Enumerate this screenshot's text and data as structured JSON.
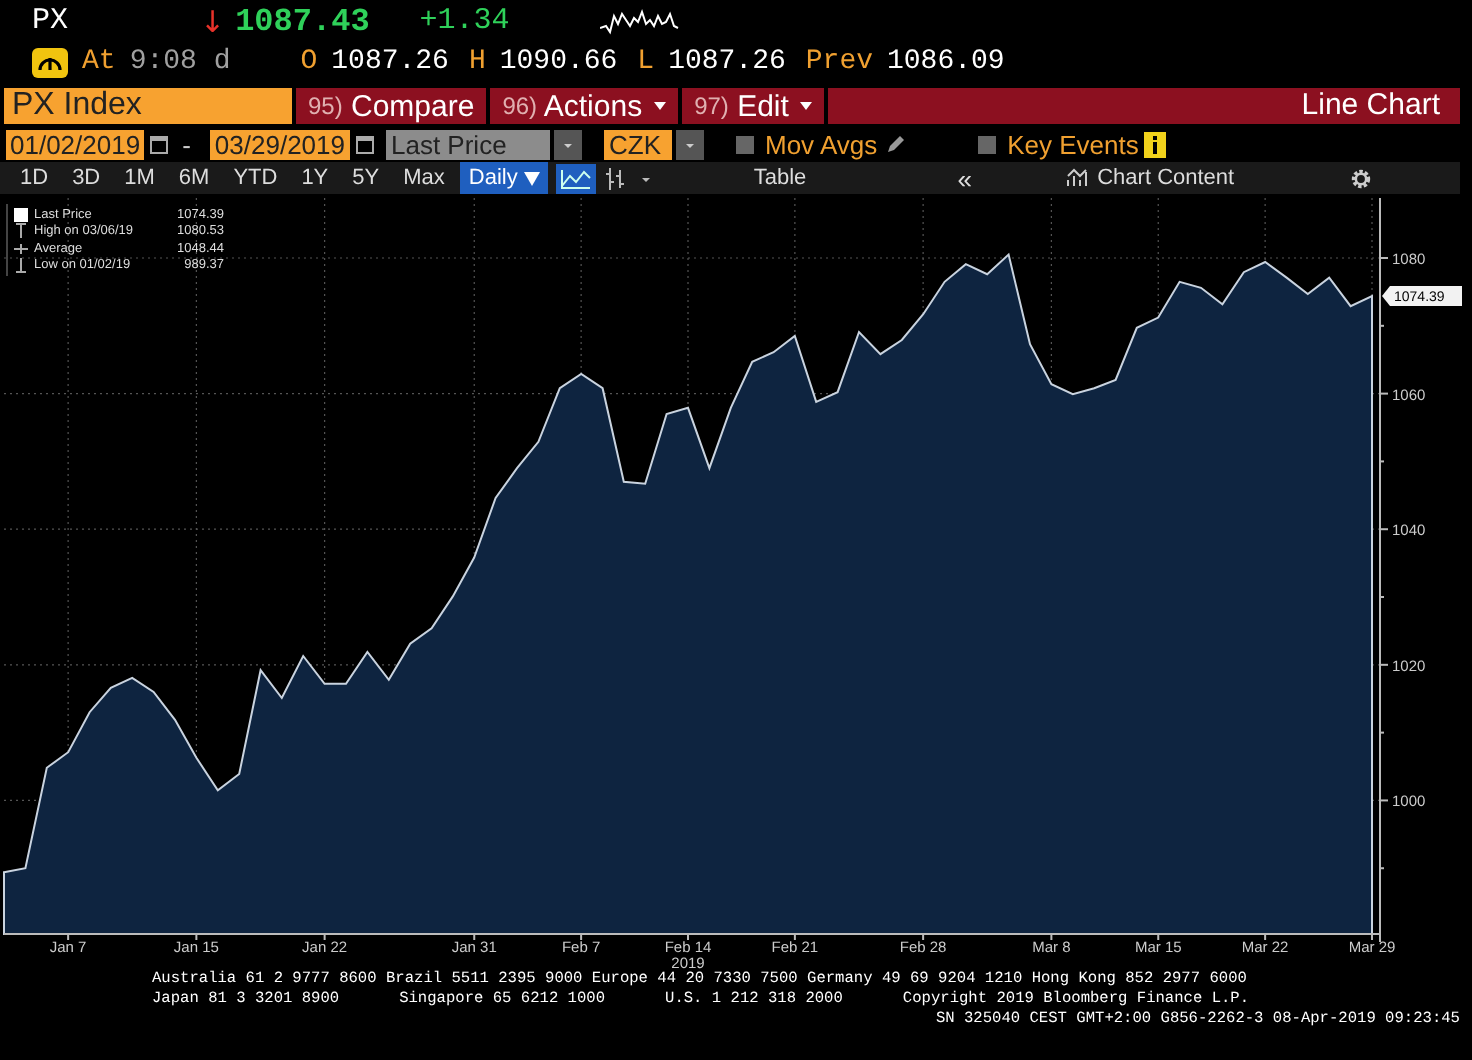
{
  "quote": {
    "ticker": "PX",
    "arrow": "↓",
    "last": "1087.43",
    "change": "+1.34",
    "time_label": "At",
    "time": "9:08 d",
    "open_label": "O",
    "open": "1087.26",
    "high_label": "H",
    "high": "1090.66",
    "low_label": "L",
    "low": "1087.26",
    "prev_label": "Prev",
    "prev": "1086.09"
  },
  "command_bar": {
    "security": "PX Index",
    "menus": [
      {
        "number": "95)",
        "label": "Compare",
        "dropdown": false
      },
      {
        "number": "96)",
        "label": "Actions",
        "dropdown": true
      },
      {
        "number": "97)",
        "label": "Edit",
        "dropdown": true
      }
    ],
    "title": "Line Chart"
  },
  "settings": {
    "start_date": "01/02/2019",
    "separator": "-",
    "end_date": "03/29/2019",
    "field": "Last Price",
    "currency": "CZK",
    "options": [
      {
        "label": "Mov Avgs",
        "checked": false,
        "kind": "edit"
      },
      {
        "label": "Key Events",
        "checked": false,
        "kind": "info"
      }
    ]
  },
  "toolbar": {
    "periods": [
      "1D",
      "3D",
      "1M",
      "6M",
      "YTD",
      "1Y",
      "5Y",
      "Max"
    ],
    "interval": "Daily",
    "view": "Table",
    "collapse": "«",
    "panel": "Chart Content"
  },
  "legend": [
    {
      "label": "Last Price",
      "value": "1074.39",
      "kind": "last"
    },
    {
      "label": "High on 03/06/19",
      "value": "1080.53",
      "kind": "high"
    },
    {
      "label": "Average",
      "value": "1048.44",
      "kind": "average"
    },
    {
      "label": "Low on 01/02/19",
      "value": "989.37",
      "kind": "low"
    }
  ],
  "chart": {
    "last_tag": "1074.39",
    "chart_data": {
      "type": "area",
      "xlabel": "2019",
      "grid": true,
      "ylim": [
        980.3,
        1088.85
      ],
      "categories": [
        null,
        null,
        null,
        "Jan 7",
        null,
        null,
        null,
        null,
        null,
        "Jan 15",
        null,
        null,
        null,
        null,
        null,
        "Jan 22",
        null,
        null,
        null,
        null,
        null,
        null,
        "Jan 31",
        null,
        null,
        null,
        null,
        "Feb 7",
        null,
        null,
        null,
        null,
        "Feb 14",
        null,
        null,
        null,
        null,
        "Feb 21",
        null,
        null,
        null,
        null,
        null,
        "Feb 28",
        null,
        null,
        null,
        null,
        null,
        "Mar 8",
        null,
        null,
        null,
        null,
        "Mar 15",
        null,
        null,
        null,
        null,
        "Mar 22",
        null,
        null,
        null,
        null,
        "Mar 29"
      ],
      "yticks": [
        1000,
        1020,
        1040,
        1060,
        1080
      ],
      "series": [
        {
          "color": "#0e2440",
          "values": [
            989.4,
            990.0,
            1004.8,
            1007.1,
            1013.0,
            1016.6,
            1018.1,
            1016.0,
            1011.9,
            1006.3,
            1001.5,
            1003.9,
            1019.2,
            1015.1,
            1021.3,
            1017.2,
            1017.2,
            1021.9,
            1017.8,
            1023.1,
            1025.4,
            1030.1,
            1035.8,
            1044.6,
            1049.0,
            1052.9,
            1060.8,
            1062.9,
            1060.8,
            1047.0,
            1046.7,
            1057.0,
            1057.9,
            1049.0,
            1057.9,
            1064.7,
            1066.1,
            1068.5,
            1058.8,
            1060.2,
            1069.1,
            1065.8,
            1067.9,
            1071.7,
            1076.5,
            1079.1,
            1077.6,
            1080.5,
            1067.3,
            1061.4,
            1059.9,
            1060.8,
            1062.0,
            1069.7,
            1071.2,
            1076.5,
            1075.6,
            1073.2,
            1077.9,
            1079.4,
            1077.1,
            1074.7,
            1077.1,
            1072.9,
            1074.4
          ]
        }
      ]
    }
  },
  "footer": [
    [
      "Australia 61 2 9777 8600 Brazil 5511 2395 9000 Europe 44 20 7330 7500 Germany 49 69 9204 1210 Hong Kong 852 2977 6000"
    ],
    [
      "Japan 81 3 3201 8900",
      "Singapore 65 6212 1000",
      "U.S. 1 212 318 2000",
      "Copyright 2019 Bloomberg Finance L.P."
    ],
    [
      "SN 325040 CEST GMT+2:00 G856-2262-3 08-Apr-2019 09:23:45"
    ]
  ]
}
